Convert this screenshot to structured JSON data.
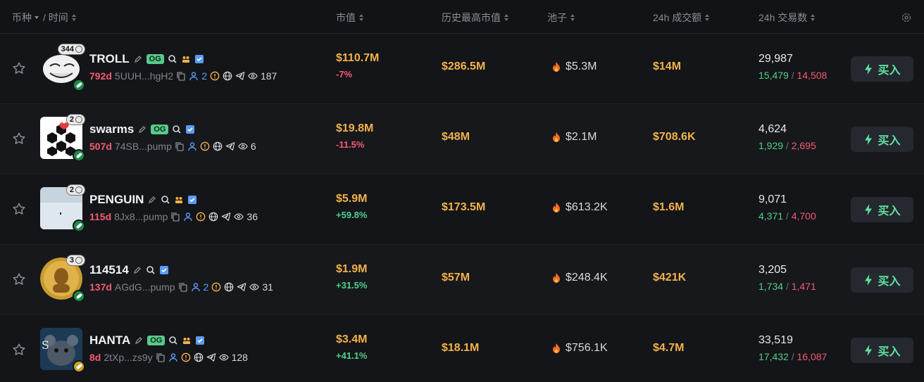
{
  "header": {
    "token": "币种",
    "time": "/ 时间",
    "market_cap": "市值",
    "ath_market_cap": "历史最高市值",
    "pool": "池子",
    "volume_24h": "24h 成交额",
    "txns_24h": "24h 交易数"
  },
  "buy_label": "买入",
  "colors": {
    "accent_orange": "#f2b24a",
    "positive": "#4fd18a",
    "negative": "#f25c73",
    "buy_green": "#5fe3a0"
  },
  "rows": [
    {
      "holders": "344",
      "ticker": "TROLL",
      "og": "OG",
      "age": "792d",
      "address": "5UUH...hgH2",
      "dev_count": "2",
      "views": "187",
      "market_cap": "$110.7M",
      "change": "-7%",
      "ath": "$286.5M",
      "pool": "$5.3M",
      "volume": "$14M",
      "txns": "29,987",
      "buys": "15,479",
      "sells": "14,508"
    },
    {
      "holders": "2",
      "ticker": "swarms",
      "og": "OG",
      "age": "507d",
      "address": "74SB...pump",
      "dev_count": "",
      "views": "6",
      "market_cap": "$19.8M",
      "change": "-11.5%",
      "ath": "$48M",
      "pool": "$2.1M",
      "volume": "$708.6K",
      "txns": "4,624",
      "buys": "1,929",
      "sells": "2,695"
    },
    {
      "holders": "2",
      "ticker": "PENGUIN",
      "og": "",
      "age": "115d",
      "address": "8Jx8...pump",
      "dev_count": "",
      "views": "36",
      "market_cap": "$5.9M",
      "change": "+59.8%",
      "ath": "$173.5M",
      "pool": "$613.2K",
      "volume": "$1.6M",
      "txns": "9,071",
      "buys": "4,371",
      "sells": "4,700"
    },
    {
      "holders": "3",
      "ticker": "114514",
      "og": "",
      "age": "137d",
      "address": "AGdG...pump",
      "dev_count": "2",
      "views": "31",
      "market_cap": "$1.9M",
      "change": "+31.5%",
      "ath": "$57M",
      "pool": "$248.4K",
      "volume": "$421K",
      "txns": "3,205",
      "buys": "1,734",
      "sells": "1,471"
    },
    {
      "holders": "",
      "ticker": "HANTA",
      "og": "OG",
      "age": "8d",
      "address": "2tXp...zs9y",
      "dev_count": "",
      "views": "128",
      "market_cap": "$3.4M",
      "change": "+41.1%",
      "ath": "$18.1M",
      "pool": "$756.1K",
      "volume": "$4.7M",
      "txns": "33,519",
      "buys": "17,432",
      "sells": "16,087"
    }
  ]
}
